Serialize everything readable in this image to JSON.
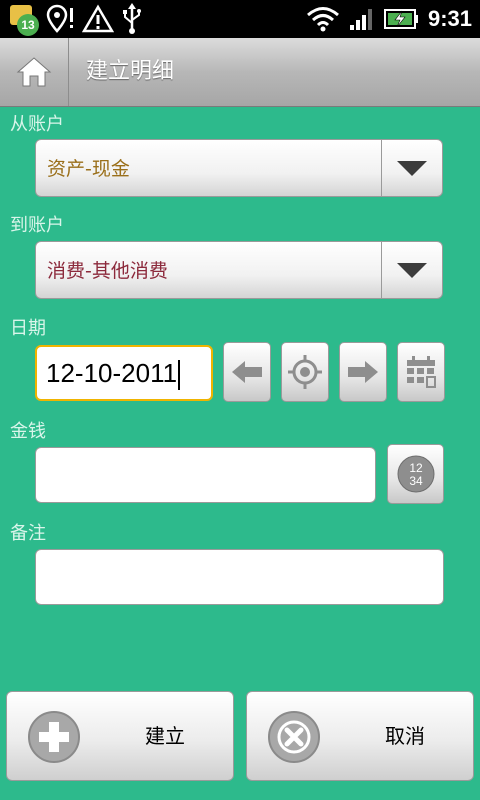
{
  "status_bar": {
    "notification_count": "13",
    "time": "9:31",
    "icons": [
      "mail-icon",
      "location-alert-icon",
      "warning-icon",
      "usb-icon",
      "wifi-icon",
      "signal-icon",
      "battery-charging-icon"
    ]
  },
  "header": {
    "title": "建立明细",
    "home_icon": "home-icon"
  },
  "form": {
    "from_account": {
      "label": "从账户",
      "value": "资产-现金",
      "color": "#9a6f1a"
    },
    "to_account": {
      "label": "到账户",
      "value": "消费-其他消费",
      "color": "#8c2a3c"
    },
    "date": {
      "label": "日期",
      "value": "12-10-2011"
    },
    "amount": {
      "label": "金钱",
      "value": ""
    },
    "note": {
      "label": "备注",
      "value": ""
    },
    "calc_icon_text": {
      "top": "12",
      "bottom": "34"
    }
  },
  "actions": {
    "create_label": "建立",
    "cancel_label": "取消"
  },
  "colors": {
    "background": "#2dba8c",
    "focus_border": "#f0b400"
  }
}
